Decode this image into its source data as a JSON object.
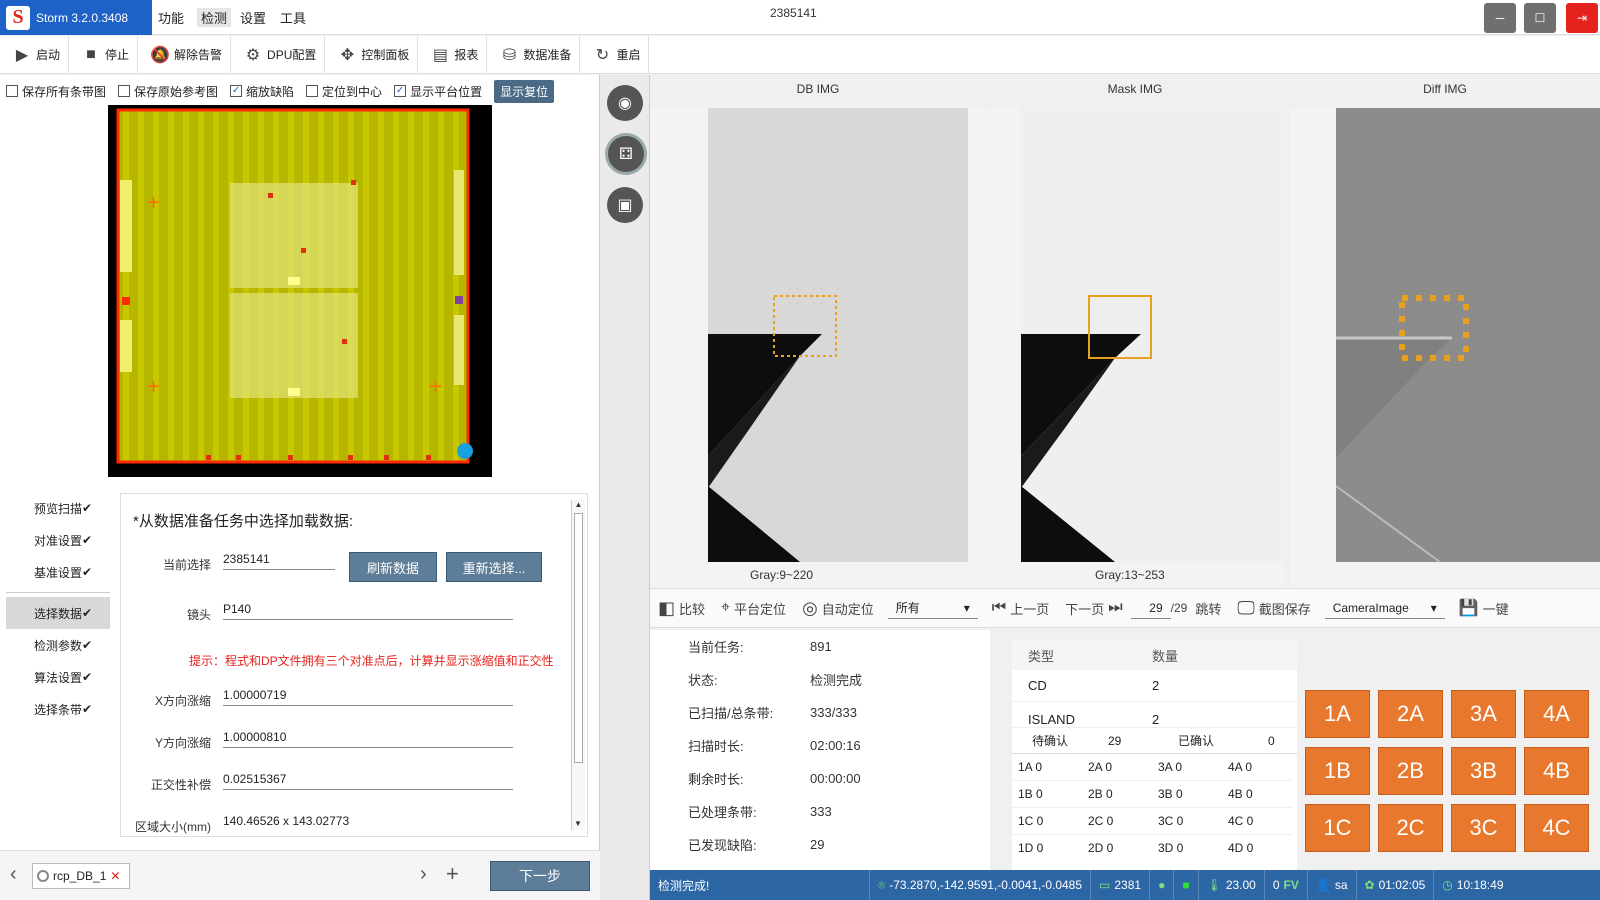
{
  "app": {
    "logo_letter": "S",
    "name": "Storm 3.2.0.3408",
    "window_title": "2385141"
  },
  "menu": [
    "功能",
    "检测",
    "设置",
    "工具"
  ],
  "toolbar": [
    {
      "label": "启动",
      "icon": "play-icon"
    },
    {
      "label": "停止",
      "icon": "stop-icon"
    },
    {
      "label": "解除告警",
      "icon": "bell-off-icon"
    },
    {
      "label": "DPU配置",
      "icon": "gear-icon"
    },
    {
      "label": "控制面板",
      "icon": "move-icon"
    },
    {
      "label": "报表",
      "icon": "report-icon"
    },
    {
      "label": "数据准备",
      "icon": "database-icon"
    },
    {
      "label": "重启",
      "icon": "restart-icon"
    }
  ],
  "options": [
    {
      "label": "保存所有条带图",
      "checked": false
    },
    {
      "label": "保存原始参考图",
      "checked": false
    },
    {
      "label": "缩放缺陷",
      "checked": true
    },
    {
      "label": "定位到中心",
      "checked": false
    },
    {
      "label": "显示平台位置",
      "checked": true
    }
  ],
  "reset_button": "显示复位",
  "sidenav": {
    "group1": [
      "预览扫描",
      "对准设置",
      "基准设置"
    ],
    "group2": [
      "选择数据",
      "检测参数",
      "算法设置",
      "选择条带"
    ],
    "active": "选择数据",
    "check": "✔"
  },
  "form": {
    "heading": "*从数据准备任务中选择加载数据:",
    "current_label": "当前选择",
    "current_value": "2385141",
    "refresh_button": "刷新数据",
    "reselect_button": "重新选择...",
    "lens_label": "镜头",
    "lens_value": "P140",
    "hint": "提示：程式和DP文件拥有三个对准点后，计算并显示涨缩值和正交性",
    "x_label": "X方向涨缩",
    "x_value": "1.00000719",
    "y_label": "Y方向涨缩",
    "y_value": "1.00000810",
    "ortho_label": "正交性补偿",
    "ortho_value": "0.02515367",
    "area_label": "区域大小(mm)",
    "area_value": "140.46526 x 143.02773"
  },
  "bottom": {
    "tab": "rcp_DB_1",
    "next_button": "下一步",
    "close": "✕",
    "add": "+",
    "prev": "‹",
    "nextarrow": "›"
  },
  "images": [
    {
      "title": "DB IMG",
      "gray": "Gray:9~220"
    },
    {
      "title": "Mask IMG",
      "gray": "Gray:13~253"
    },
    {
      "title": "Diff IMG",
      "gray": ""
    }
  ],
  "image_toolbar": {
    "compare": "比较",
    "stage_locate": "平台定位",
    "auto_locate": "自动定位",
    "filter": "所有",
    "prev_page": "上一页",
    "next_page": "下一页",
    "page_value": "29",
    "page_total": "/29",
    "jump": "跳转",
    "screenshot": "截图保存",
    "camera_select": "CameraImage",
    "one_key": "一键"
  },
  "info": [
    {
      "k": "当前任务:",
      "v": "891"
    },
    {
      "k": "状态:",
      "v": "检测完成"
    },
    {
      "k": "已扫描/总条带:",
      "v": "333/333"
    },
    {
      "k": "扫描时长:",
      "v": "02:00:16"
    },
    {
      "k": "剩余时长:",
      "v": "00:00:00"
    },
    {
      "k": "已处理条带:",
      "v": "333"
    },
    {
      "k": "已发现缺陷:",
      "v": "29"
    }
  ],
  "defects": {
    "col_type": "类型",
    "col_count": "数量",
    "rows": [
      {
        "type": "CD",
        "count": "2"
      },
      {
        "type": "ISLAND",
        "count": "2"
      }
    ],
    "pending_label": "待确认",
    "pending_value": "29",
    "confirmed_label": "已确认",
    "confirmed_value": "0",
    "cells": [
      [
        "1A 0",
        "2A 0",
        "3A 0",
        "4A 0"
      ],
      [
        "1B 0",
        "2B 0",
        "3B 0",
        "4B 0"
      ],
      [
        "1C 0",
        "2C 0",
        "3C 0",
        "4C 0"
      ],
      [
        "1D 0",
        "2D 0",
        "3D 0",
        "4D 0"
      ]
    ]
  },
  "grid_buttons": [
    [
      "1A",
      "2A",
      "3A",
      "4A"
    ],
    [
      "1B",
      "2B",
      "3B",
      "4B"
    ],
    [
      "1C",
      "2C",
      "3C",
      "4C"
    ]
  ],
  "status": {
    "message": "检测完成!",
    "coords": "-73.2870,-142.9591,-0.0041,-0.0485",
    "job": "2381",
    "temp": "23.00",
    "count": "0",
    "fv": "FV",
    "user": "sa",
    "elapsed": "01:02:05",
    "clock": "10:18:49"
  },
  "colors": {
    "accent": "#1e62c8",
    "orange": "#e8782d",
    "status_bar": "#2c66a5",
    "wafer_yellow": "#b8b800"
  }
}
